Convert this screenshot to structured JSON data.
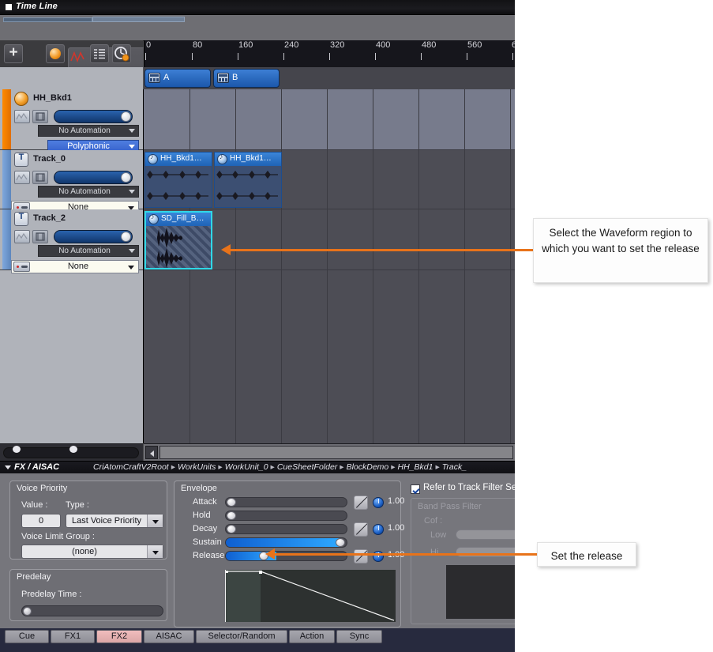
{
  "window": {
    "title": "Time Line",
    "icon": "window-square-icon"
  },
  "toolbar": {
    "buttons": [
      {
        "name": "add-button",
        "icon": "plus-icon",
        "label": "+"
      },
      {
        "name": "cue-orb-button",
        "icon": "orange-sphere-icon",
        "label": ""
      },
      {
        "name": "envelope-button",
        "icon": "zigzag-curve-icon",
        "label": ""
      },
      {
        "name": "list-button",
        "icon": "list-lines-icon",
        "label": ""
      },
      {
        "name": "clock-button",
        "icon": "clock-orb-icon",
        "label": ""
      }
    ]
  },
  "ruler": {
    "ticks": [
      "0",
      "80",
      "160",
      "240",
      "320",
      "400",
      "480",
      "560",
      "6"
    ]
  },
  "blocks": [
    {
      "label": "A",
      "icon": "block-icon"
    },
    {
      "label": "B",
      "icon": "block-icon"
    }
  ],
  "tracks": [
    {
      "name": "HH_Bkd1",
      "icon": "orange-sphere-icon",
      "automation": "No Automation",
      "mode": "Polyphonic",
      "accent": "#ff8a00"
    },
    {
      "name": "Track_0",
      "icon": "track-t-icon",
      "automation": "No Automation",
      "mode": "None",
      "accent": "#7fa8dd"
    },
    {
      "name": "Track_2",
      "icon": "track-t-icon",
      "automation": "No Automation",
      "mode": "None",
      "accent": "#7fa8dd"
    }
  ],
  "clips": [
    {
      "label": "HH_Bkd1…",
      "icon": "waveform-orb-icon",
      "selected": false
    },
    {
      "label": "HH_Bkd1…",
      "icon": "waveform-orb-icon",
      "selected": false
    },
    {
      "label": "SD_Fill_B…",
      "icon": "waveform-orb-icon",
      "selected": true
    }
  ],
  "breadcrumb": {
    "panel_label": "FX / AISAC",
    "path": [
      "CriAtomCraftV2Root",
      "WorkUnits",
      "WorkUnit_0",
      "CueSheetFolder",
      "BlockDemo",
      "HH_Bkd1",
      "Track_"
    ],
    "separator": "▸"
  },
  "voice_priority": {
    "title": "Voice Priority",
    "value_label": "Value :",
    "value": "0",
    "type_label": "Type :",
    "type_value": "Last Voice Priority",
    "group_label": "Voice Limit Group :",
    "group_value": "(none)"
  },
  "predelay": {
    "title": "Predelay",
    "time_label": "Predelay Time :",
    "time_percent": 0
  },
  "envelope": {
    "title": "Envelope",
    "rows": [
      {
        "label": "Attack",
        "percent": 2,
        "curve": true,
        "knob": true,
        "knob_value": "1.00"
      },
      {
        "label": "Hold",
        "percent": 2,
        "curve": false,
        "knob": false,
        "knob_value": ""
      },
      {
        "label": "Decay",
        "percent": 2,
        "curve": true,
        "knob": true,
        "knob_value": "1.00"
      },
      {
        "label": "Sustain",
        "percent": 95,
        "curve": false,
        "knob": false,
        "knob_value": ""
      },
      {
        "label": "Release",
        "percent": 40,
        "curve": true,
        "knob": true,
        "knob_value": "1.00"
      }
    ]
  },
  "filter": {
    "refer_label": "Refer to Track Filter Sett",
    "refer_checked": true,
    "title": "Band Pass Filter",
    "cof_label": "Cof :",
    "low_label": "Low",
    "hi_label": "Hi"
  },
  "tabs": {
    "items": [
      "Cue",
      "FX1",
      "FX2",
      "AISAC",
      "Selector/Random",
      "Action",
      "Sync"
    ],
    "active": "FX2"
  },
  "annotations": [
    {
      "name": "waveform-callout",
      "text": "Select the Waveform region to which you want to set the release"
    },
    {
      "name": "release-callout",
      "text": "Set the release"
    }
  ],
  "colors": {
    "accent_orange": "#e8731a",
    "selection_cyan": "#2fd8e8",
    "blue": "#2a63ae"
  }
}
